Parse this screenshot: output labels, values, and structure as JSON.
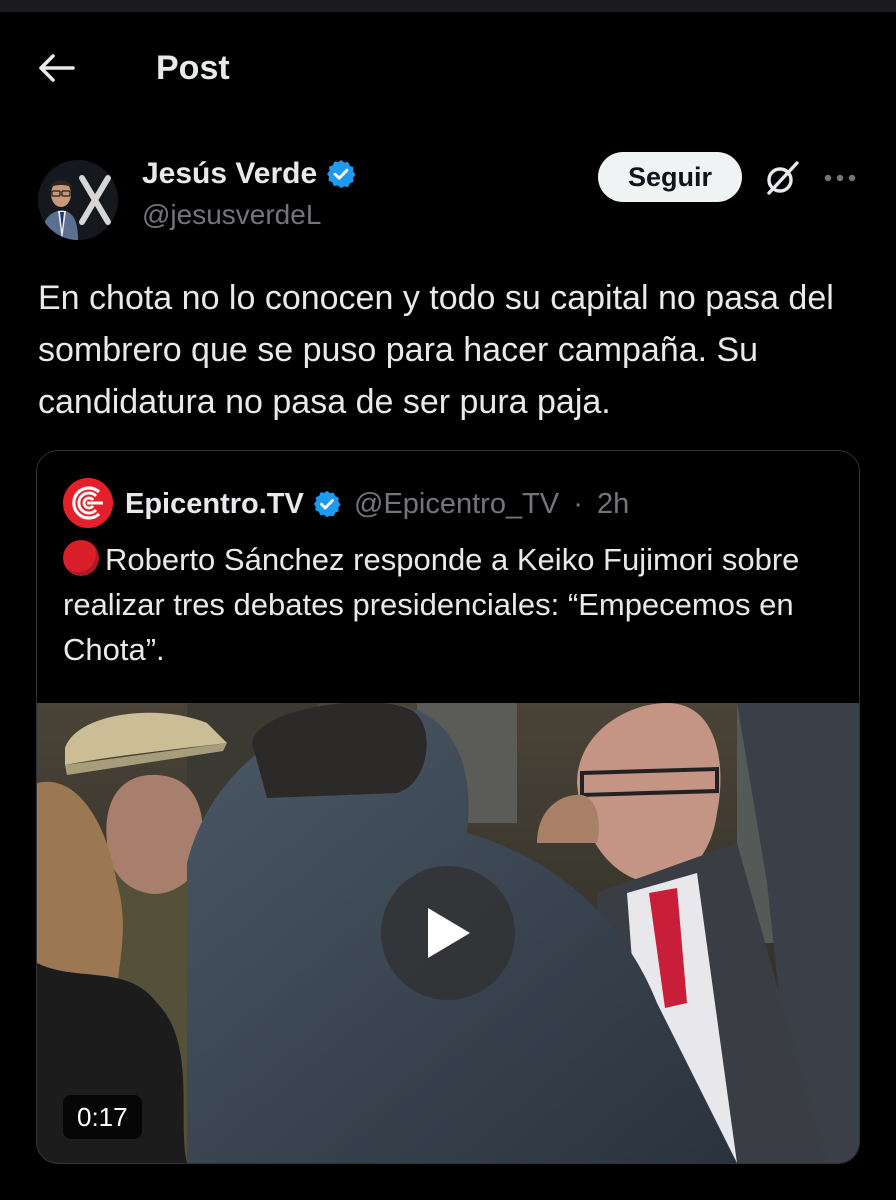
{
  "header": {
    "back_icon": "arrow-left-icon",
    "title": "Post"
  },
  "post": {
    "author": {
      "name": "Jesús Verde",
      "handle": "@jesusverdeL",
      "verified": true,
      "verified_color": "#1d9bf0"
    },
    "actions": {
      "follow_label": "Seguir",
      "grok_icon": "grok-icon",
      "more_icon": "more-horizontal-icon"
    },
    "text": "En chota no lo conocen y todo su capital no pasa del sombrero que se puso para hacer campaña. Su candidatura no pasa de ser pura paja."
  },
  "quote": {
    "author": {
      "name": "Epicentro.TV",
      "handle": "@Epicentro_TV",
      "separator": "·",
      "time": "2h",
      "verified": true,
      "logo_color": "#e4202a"
    },
    "emoji_icon": "red-circle-icon",
    "text": "Roberto Sánchez responde a Keiko Fujimori sobre realizar tres debates presidenciales: “Empecemos en Chota”.",
    "video": {
      "duration": "0:17",
      "play_icon": "play-icon"
    }
  },
  "colors": {
    "background": "#000000",
    "text": "#e7e9ea",
    "secondary_text": "#71767b",
    "border": "#2f3336",
    "follow_button_bg": "#eff3f4"
  }
}
